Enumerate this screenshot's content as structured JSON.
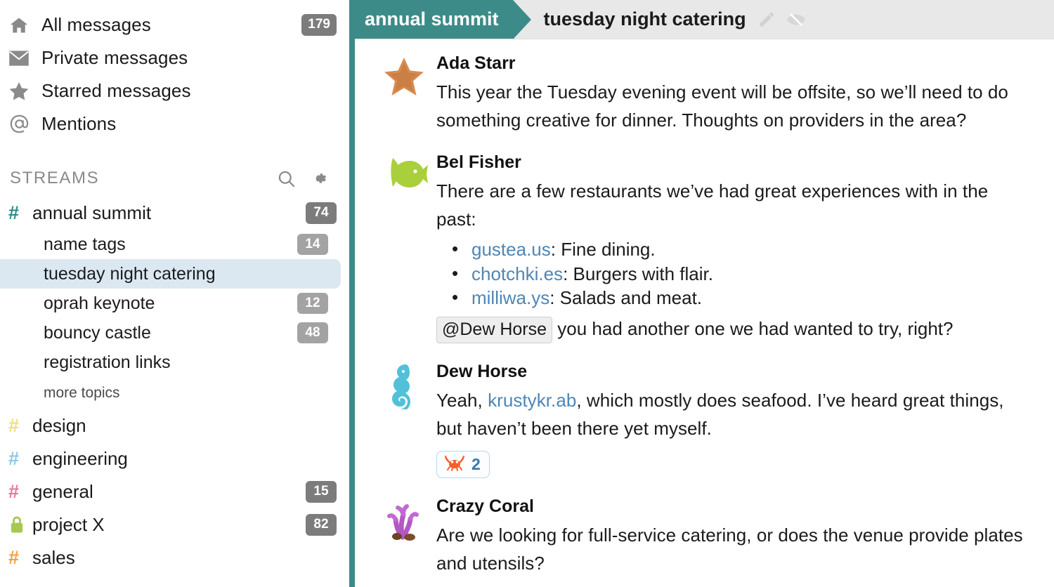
{
  "sidebar": {
    "nav_items": [
      {
        "label": "All messages",
        "icon": "home-icon",
        "badge": "179"
      },
      {
        "label": "Private messages",
        "icon": "envelope-icon",
        "badge": ""
      },
      {
        "label": "Starred messages",
        "icon": "star-icon",
        "badge": ""
      },
      {
        "label": "Mentions",
        "icon": "at-sign-icon",
        "badge": ""
      }
    ],
    "streams_header": {
      "title": "STREAMS",
      "search_icon": "search-icon",
      "gear_icon": "gear-icon"
    },
    "streams": [
      {
        "name": "annual summit",
        "icon": "hash-icon",
        "color": "#2b8a86",
        "badge": "74",
        "private": false
      },
      {
        "name": "design",
        "icon": "hash-icon",
        "color": "#f2dd7e",
        "badge": "",
        "private": false
      },
      {
        "name": "engineering",
        "icon": "hash-icon",
        "color": "#8fc7e8",
        "badge": "",
        "private": false
      },
      {
        "name": "general",
        "icon": "hash-icon",
        "color": "#e8779b",
        "badge": "15",
        "private": false
      },
      {
        "name": "project X",
        "icon": "lock-icon",
        "color": "#a7c853",
        "badge": "82",
        "private": true
      },
      {
        "name": "sales",
        "icon": "hash-icon",
        "color": "#f2a03d",
        "badge": "",
        "private": false
      }
    ],
    "topics": [
      {
        "name": "name tags",
        "badge": "14",
        "selected": false
      },
      {
        "name": "tuesday night catering",
        "badge": "",
        "selected": true
      },
      {
        "name": "oprah keynote",
        "badge": "12",
        "selected": false
      },
      {
        "name": "bouncy castle",
        "badge": "48",
        "selected": false
      },
      {
        "name": "registration links",
        "badge": "",
        "selected": false
      }
    ],
    "more_topics_label": "more topics"
  },
  "topic_bar": {
    "stream_label": "annual summit",
    "topic_label": "tuesday night catering",
    "edit_icon": "pencil-icon",
    "mute_icon": "eye-slash-icon",
    "stream_color": "#3d8b88"
  },
  "messages": [
    {
      "sender": "Ada Starr",
      "avatar": "starfish-icon",
      "text": "This year the Tuesday evening event will be offsite, so we’ll need to do something creative for dinner. Thoughts on providers in the area?"
    },
    {
      "sender": "Bel Fisher",
      "avatar": "fish-icon",
      "text": "There are a few restaurants we’ve had great experiences with in the past:",
      "bullets": [
        {
          "link": "gustea.us",
          "rest": ": Fine dining."
        },
        {
          "link": "chotchki.es",
          "rest": ": Burgers with flair."
        },
        {
          "link": "milliwa.ys",
          "rest": ": Salads and meat."
        }
      ],
      "mention": "@Dew Horse",
      "mention_rest": "you had another one we had wanted to try, right?"
    },
    {
      "sender": "Dew Horse",
      "avatar": "seahorse-icon",
      "text_before": "Yeah, ",
      "link": "krustykr.ab",
      "text_after": ", which mostly does seafood. I’ve heard great things, but haven’t been there yet myself.",
      "reaction": {
        "emoji": "crab-icon",
        "count": "2"
      }
    },
    {
      "sender": "Crazy Coral",
      "avatar": "coral-icon",
      "text": "Are we looking for full-service catering, or does the venue provide plates and utensils?"
    }
  ]
}
